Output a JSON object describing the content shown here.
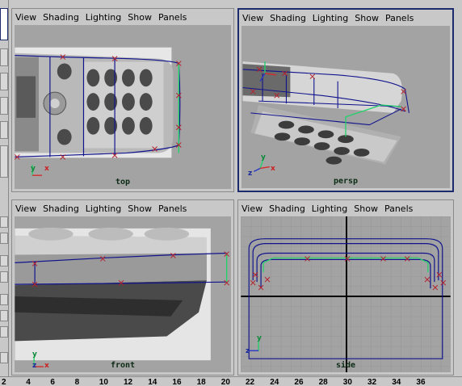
{
  "menu": [
    "View",
    "Shading",
    "Lighting",
    "Show",
    "Panels"
  ],
  "panes": {
    "top": {
      "camera": "top"
    },
    "persp": {
      "camera": "persp"
    },
    "front": {
      "camera": "front"
    },
    "side": {
      "camera": "side"
    }
  },
  "axes": {
    "x": "x",
    "y": "y",
    "z": "z"
  },
  "timeline": [
    "2",
    "4",
    "6",
    "8",
    "10",
    "12",
    "14",
    "16",
    "18",
    "20",
    "22",
    "24",
    "26",
    "28",
    "30",
    "32",
    "34",
    "36"
  ],
  "colors": {
    "curve": "#10138c",
    "cv": "#b3222e",
    "selected": "#23d16b",
    "viewport_bg": "#a3a3a3",
    "active_border": "#1c2a6e"
  }
}
